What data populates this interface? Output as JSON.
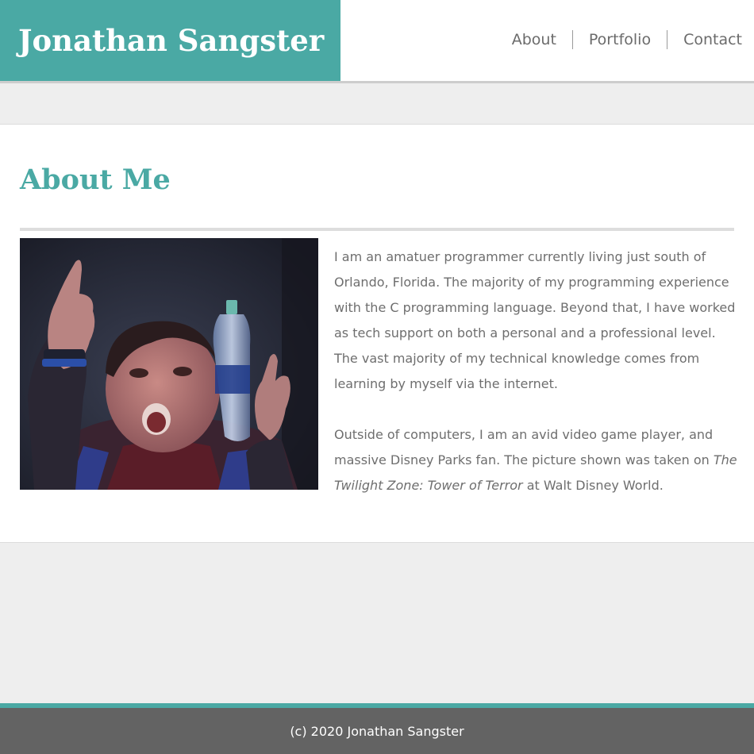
{
  "header": {
    "site_title": "Jonathan Sangster",
    "nav": [
      {
        "label": "About"
      },
      {
        "label": "Portfolio"
      },
      {
        "label": "Contact"
      }
    ]
  },
  "about": {
    "heading": "About Me",
    "photo_alt": "Photo of Jonathan on The Twilight Zone: Tower of Terror",
    "paragraph1": "I am an amatuer programmer currently living just south of Orlando, Florida. The majority of my programming experience with the C programming language. Beyond that, I have worked as tech support on both a personal and a professional level. The vast majority of my technical knowledge comes from learning by myself via the internet.",
    "paragraph2_before": "Outside of computers, I am an avid video game player, and massive Disney Parks fan. The picture shown was taken on ",
    "paragraph2_em": "The Twilight Zone: Tower of Terror",
    "paragraph2_after": " at Walt Disney World."
  },
  "footer": {
    "copyright": "(c) 2020 Jonathan Sangster"
  },
  "colors": {
    "accent": "#4aa9a4",
    "text": "#6e6e6e",
    "footer_bg": "#636363",
    "page_bg": "#eeeeee"
  }
}
